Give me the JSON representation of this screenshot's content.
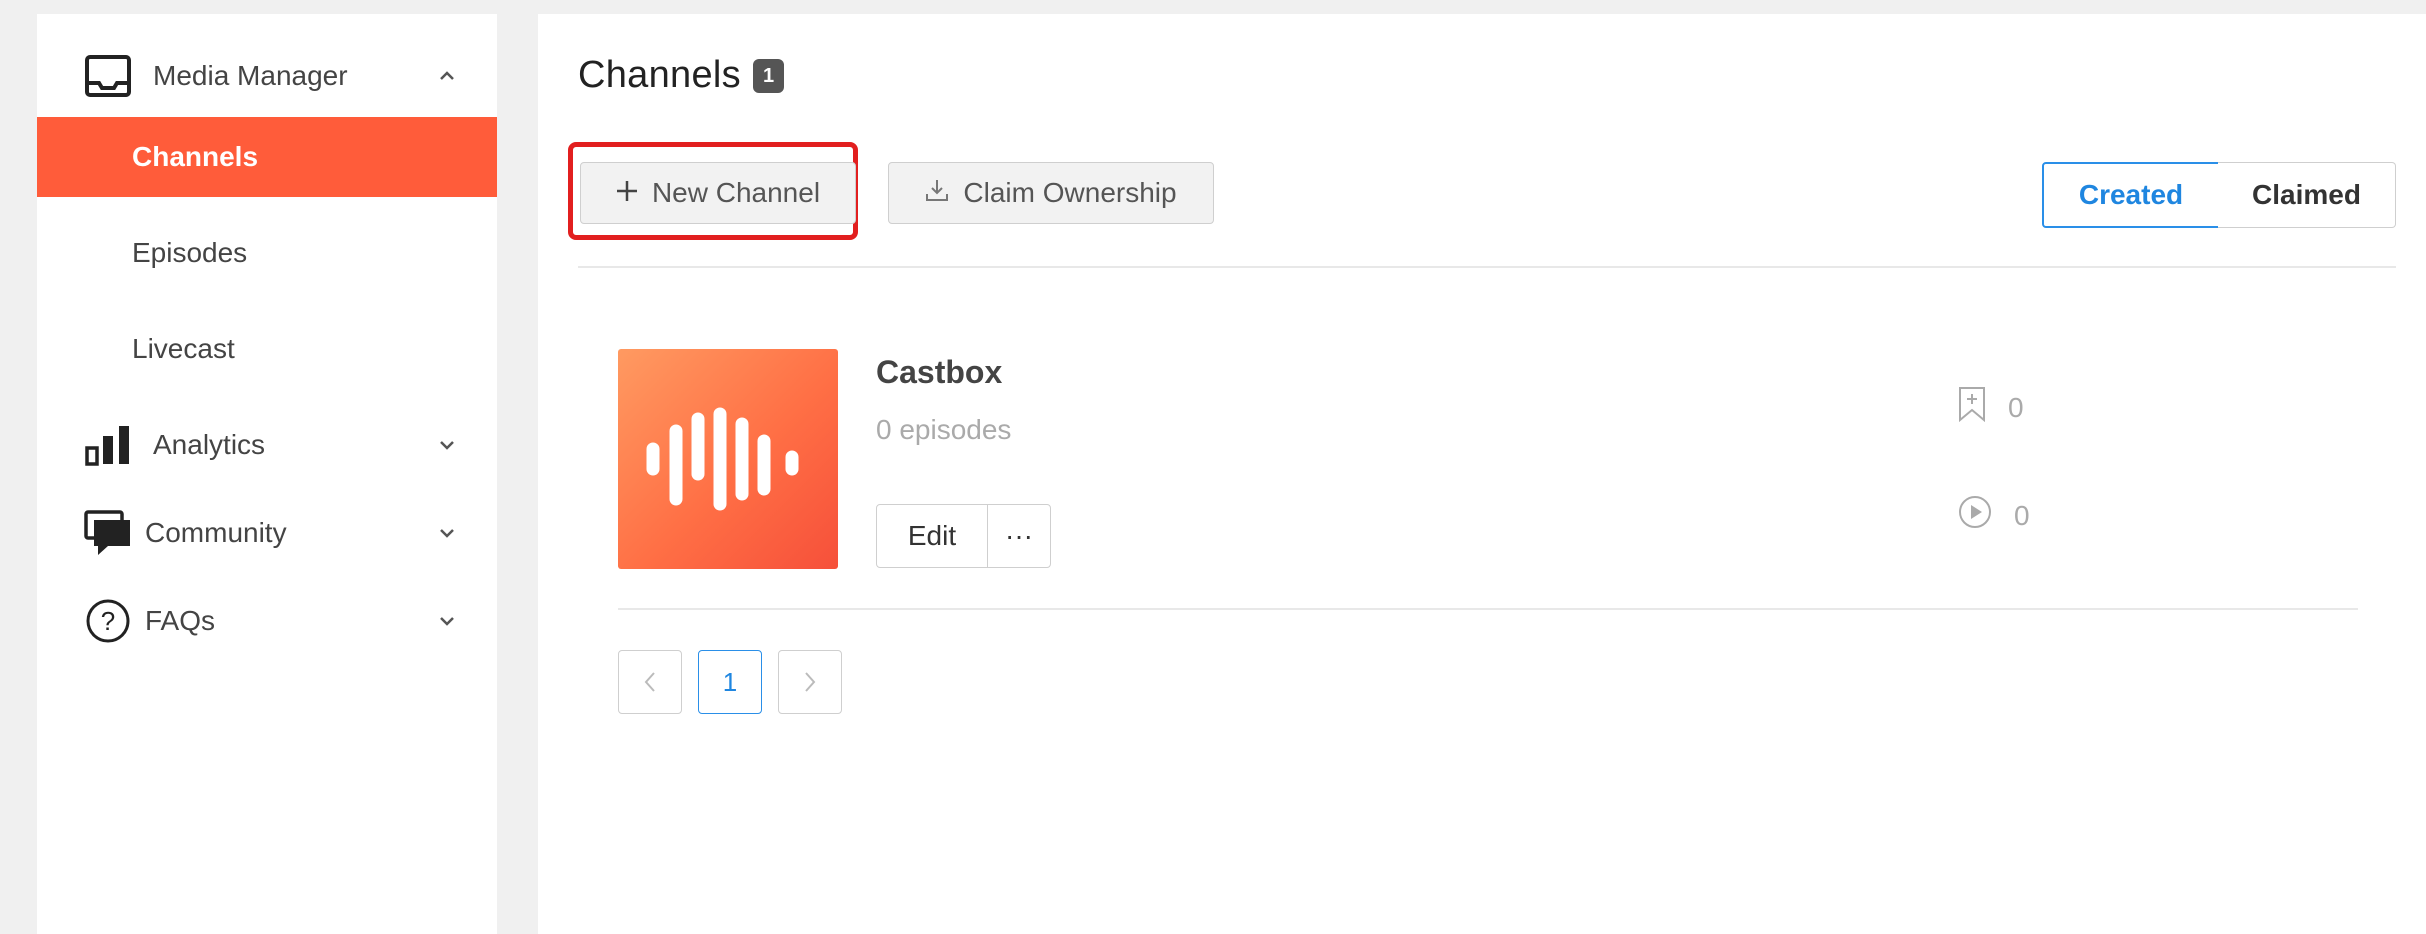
{
  "sidebar": {
    "media_manager": {
      "label": "Media Manager"
    },
    "items": [
      {
        "label": "Channels"
      },
      {
        "label": "Episodes"
      },
      {
        "label": "Livecast"
      }
    ],
    "analytics": {
      "label": "Analytics"
    },
    "community": {
      "label": "Community"
    },
    "faqs": {
      "label": "FAQs"
    }
  },
  "header": {
    "title": "Channels",
    "count": "1"
  },
  "toolbar": {
    "new_channel": "New Channel",
    "claim_ownership": "Claim Ownership",
    "tab_created": "Created",
    "tab_claimed": "Claimed"
  },
  "channel": {
    "title": "Castbox",
    "episodes": "0 episodes",
    "edit_label": "Edit",
    "more_label": "···",
    "subscribers": "0",
    "plays": "0"
  },
  "pagination": {
    "current": "1"
  },
  "colors": {
    "accent": "#ff5c3a",
    "link_blue": "#1f86e0",
    "highlight_red": "#e21f1f"
  }
}
